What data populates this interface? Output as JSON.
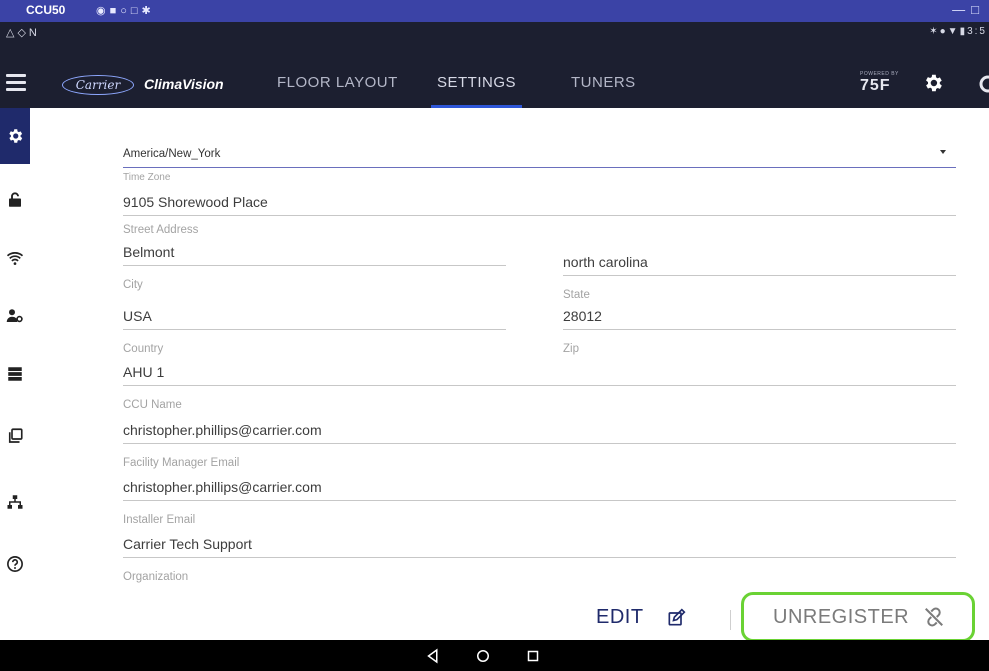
{
  "window": {
    "title": "CCU50"
  },
  "app": {
    "brand_logo": "Carrier",
    "brand_name": "ClimaVision",
    "tabs": [
      {
        "label": "FLOOR LAYOUT",
        "active": false
      },
      {
        "label": "SETTINGS",
        "active": true
      },
      {
        "label": "TUNERS",
        "active": false
      }
    ],
    "powered_by": "POWERED BY",
    "powered_logo": "75F"
  },
  "sidebar": {
    "items": [
      {
        "icon": "gear-icon",
        "active": true
      },
      {
        "icon": "unlock-icon",
        "active": false
      },
      {
        "icon": "wifi-icon",
        "active": false
      },
      {
        "icon": "user-settings-icon",
        "active": false
      },
      {
        "icon": "server-icon",
        "active": false
      },
      {
        "icon": "copy-icon",
        "active": false
      },
      {
        "icon": "network-icon",
        "active": false
      },
      {
        "icon": "help-icon",
        "active": false
      }
    ]
  },
  "form": {
    "timezone": {
      "value": "America/New_York",
      "label": "Time Zone"
    },
    "street": {
      "value": "9105 Shorewood Place",
      "label": "Street Address"
    },
    "city": {
      "value": "Belmont",
      "label": "City"
    },
    "state": {
      "value": "north carolina",
      "label": "State"
    },
    "country": {
      "value": "USA",
      "label": "Country"
    },
    "zip": {
      "value": "28012",
      "label": "Zip"
    },
    "ccu_name": {
      "value": "AHU 1",
      "label": "CCU Name"
    },
    "fm_email": {
      "value": "christopher.phillips@carrier.com",
      "label": "Facility Manager Email"
    },
    "installer_email": {
      "value": "christopher.phillips@carrier.com",
      "label": "Installer Email"
    },
    "organization": {
      "value": "Carrier Tech Support",
      "label": "Organization"
    }
  },
  "actions": {
    "edit_label": "EDIT",
    "separator": "|",
    "unregister_label": "UNREGISTER"
  },
  "colors": {
    "accent": "#2e56d8",
    "navy": "#1f2a6b",
    "highlight": "#6ad234",
    "titlebar": "#3b43a6"
  }
}
